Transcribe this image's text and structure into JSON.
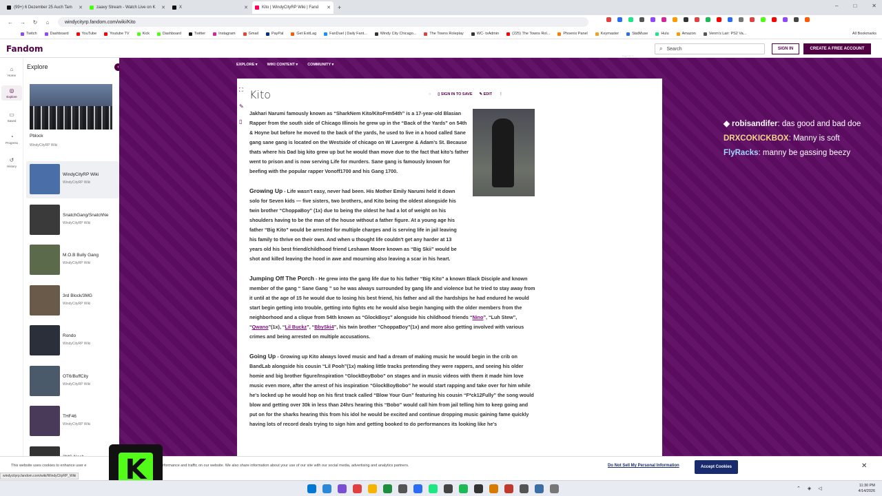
{
  "browser": {
    "tabs": [
      {
        "title": "(99+) 6 Dezember 25 Auch Tam",
        "color": "#111111"
      },
      {
        "title": "zaavy Stream - Watch Live on K",
        "color": "#53fc18"
      },
      {
        "title": "X",
        "color": "#111111"
      },
      {
        "title": "Kito | WindyCityRP Wiki | Fand",
        "color": "#fa005a",
        "active": true
      }
    ],
    "new_tab": "+",
    "url": "windycityrp.fandom.com/wiki/Kito",
    "window_controls": [
      "–",
      "□",
      "✕"
    ],
    "bookmarks": [
      {
        "label": "Twitch",
        "color": "#9146ff"
      },
      {
        "label": "Dashboard",
        "color": "#9146ff"
      },
      {
        "label": "YouTube",
        "color": "#ff0000"
      },
      {
        "label": "Youtube TV",
        "color": "#ff0000"
      },
      {
        "label": "Kick",
        "color": "#53fc18"
      },
      {
        "label": "Dashboard",
        "color": "#53fc18"
      },
      {
        "label": "Twitter",
        "color": "#111111"
      },
      {
        "label": "Instagram",
        "color": "#d6249f"
      },
      {
        "label": "Gmail",
        "color": "#ea4335"
      },
      {
        "label": "PayPal",
        "color": "#003087"
      },
      {
        "label": "Get ExitLag",
        "color": "#ff5a00"
      },
      {
        "label": "FanDuel | Daily Fant...",
        "color": "#1493ff"
      },
      {
        "label": "Windy City Chicago...",
        "color": "#333333"
      },
      {
        "label": "The Towns Roleplay",
        "color": "#e04040"
      },
      {
        "label": "WC- txAdmin",
        "color": "#333333"
      },
      {
        "label": "(225) The Towns Rol...",
        "color": "#ff0000"
      },
      {
        "label": "Phoenix Panel",
        "color": "#ff7a00"
      },
      {
        "label": "Keymaster",
        "color": "#f4a020"
      },
      {
        "label": "StatMuse",
        "color": "#2a6df4"
      },
      {
        "label": "Hulu",
        "color": "#1ce783"
      },
      {
        "label": "Amazon",
        "color": "#ff9900"
      },
      {
        "label": "Venm's Lair: PS2 Va...",
        "color": "#555555"
      }
    ],
    "all_bookmarks": "All Bookmarks"
  },
  "fandom": {
    "logo": "Fandom",
    "search_placeholder": "Search",
    "sign_in": "SIGN IN",
    "create_account": "CREATE A FREE ACCOUNT",
    "rail": [
      {
        "label": "Home",
        "icon": "⌂"
      },
      {
        "label": "Explore",
        "icon": "◎",
        "active": true
      },
      {
        "label": "Saved",
        "icon": "▭"
      },
      {
        "label": "Progress",
        "icon": "◔"
      },
      {
        "label": "History",
        "icon": "↺"
      }
    ],
    "explore": {
      "title": "Explore",
      "featured": {
        "name": "Pblock",
        "sub": "WindyCityRP Wiki"
      },
      "items": [
        {
          "name": "WindyCityRP Wiki",
          "sub": "WindyCityRP Wiki",
          "color": "#4a6fa8",
          "highlighted": true
        },
        {
          "name": "SnatchGang/SnatchNe",
          "sub": "WindyCityRP Wiki",
          "color": "#3a3a3a"
        },
        {
          "name": "M.O.B Bully Gang",
          "sub": "WindyCityRP Wiki",
          "color": "#5a6a4a"
        },
        {
          "name": "3rd Block/3MG",
          "sub": "WindyCityRP Wiki",
          "color": "#6a5a4a"
        },
        {
          "name": "Rondo",
          "sub": "WindyCityRP Wiki",
          "color": "#2a2f3a"
        },
        {
          "name": "OT6/BuffCity",
          "sub": "WindyCityRP Wiki",
          "color": "#4a5a6a"
        },
        {
          "name": "THF46",
          "sub": "WindyCityRP Wiki",
          "color": "#4a3a5a"
        },
        {
          "name": "3MG Nash",
          "sub": "",
          "color": "#333333"
        }
      ]
    }
  },
  "wiki": {
    "nav": [
      "EXPLORE ▾",
      "WIKI CONTENT ▾",
      "COMMUNITY ▾"
    ],
    "pages_label": "PAGES",
    "title": "Kito",
    "actions": {
      "sign_in_save": "SIGN IN TO SAVE",
      "edit": "EDIT"
    },
    "intro": "Jakhari Narumi famously known as “SharkNem Kito/KitoFrm54th” is a 17-year-old Blasian Rapper from the south side of Chicago Illinois he grew up in the “Back of the Yards” on 54th & Hoyne but before he moved to the back of the yards, he used to live in a hood called Sane gang sane gang is located on the Westside of chicago on W Lavergne & Adam’s St. Because thats where his Dad big kito grew up but he would than move due to the fact that kito’s father went to prison and is now serving Life for murders. Sane gang is famously known for beefing with the popular rapper Vonoff1700 and his Gang 1700.",
    "sections": [
      {
        "heading": "Growing Up",
        "text": " - Life wasn't easy, never had been. His Mother Emily Narumi held it down solo for Seven kids — five sisters, two brothers, and Kito being the oldest alongside his twin brother “ChoppaBoy” (1x) due to being the oldest he had a lot of weight on his shoulders having to be the man of the house without a father figure. At a young age his father “Big Kito” would be arrested for multiple charges and is serving life in jail leaving his family to thrive on their own. And when u thought life couldn't get any harder at 13 years old his best friend/childhood friend Leshawn Moore known as “Big Skii” would be shot and killed leaving the hood in awe and mourning also leaving a scar in his heart."
      },
      {
        "heading": "Jumping Off The Porch",
        "text_a": " - He grew into the gang life due to his father “Big Kito” a known Black Disciple and known member of the gang “ Sane Gang ” so he was always surrounded by gang life and violence but he tried to stay away from it until at the age of 15 he would due to losing his best friend, his father and all the hardships he had endured he would start begin getting into trouble, getting into fights etc he would also begin hanging with the older members from the neighborhood and a clique from 54th known as “GlockBoyz” alongside his childhood friends “",
        "link1": "Nino",
        "text_b": "”, “Luh Stew”, “",
        "link2": "Qwano",
        "text_c": "”(1x), “",
        "link3": "Lil Buckz",
        "text_d": "”, “",
        "link4": "BbySki4",
        "text_e": "”, his twin brother “ChoppaBoy”(1x) and more also getting involved with various crimes and being arrested on multiple accusations."
      },
      {
        "heading": "Going Up",
        "text": " - Growing up Kito always loved music and had a dream of making music he would begin in the crib on BandLab alongside his cousin “Lil Pooh”(1x) making little tracks pretending they were rappers, and seeing his older homie and big brother figure/Inspiration “GlockBoyBobo” on stages and in music videos with them it made him love music even more, after the arrest of his inspiration “GlockBoyBobo” he would start rapping and take over for him while he's locked up he would hop on his first track called “Blow Your Gun” featuring his cousin “F*ck12Fully” the song would blow and getting over 30k in less than 24hrs hearing this “Bobo” would call him from jail telling him to keep going and put on for the sharks hearing this from his idol he would be excited and continue dropping music gaining fame quickly having lots of record deals trying to sign him and getting booked to do performances its looking like he's"
      }
    ]
  },
  "chat": [
    {
      "user": "robisandifer",
      "message": ": das good and bad doe",
      "color": "#f8f8f8"
    },
    {
      "user": "DRXCOKICKBOX",
      "message": ": Manny is soft",
      "color": "#f5d78a"
    },
    {
      "user": "FlyRacks",
      "message": ": manny be gassing beezy",
      "color": "#9fd8ff"
    }
  ],
  "cookie": {
    "text_left": "This website uses cookies to enhance user e",
    "text_right": "rformance and traffic on our website. We also share information about your use of our site with our social media, advertising and analytics partners.",
    "do_not_sell": "Do Not Sell My Personal Information",
    "accept": "Accept Cookies",
    "close": "✕"
  },
  "status_url": "windycityrp.fandom.com/wiki/WindyCityRP_Wiki",
  "overlay": {
    "kick_logo": "K"
  },
  "taskbar": {
    "time": "11:30 PM",
    "date": "4/14/2026",
    "icons": [
      "#0078d4",
      "#2b88d8",
      "#7a4fd6",
      "#e04040",
      "#f4b400",
      "#1e8e3e",
      "#555555",
      "#2a6df4",
      "#1ce783",
      "#444444",
      "#1db954",
      "#333333",
      "#d97a00",
      "#c0392b",
      "#555555",
      "#3a6ea5",
      "#777777"
    ]
  }
}
